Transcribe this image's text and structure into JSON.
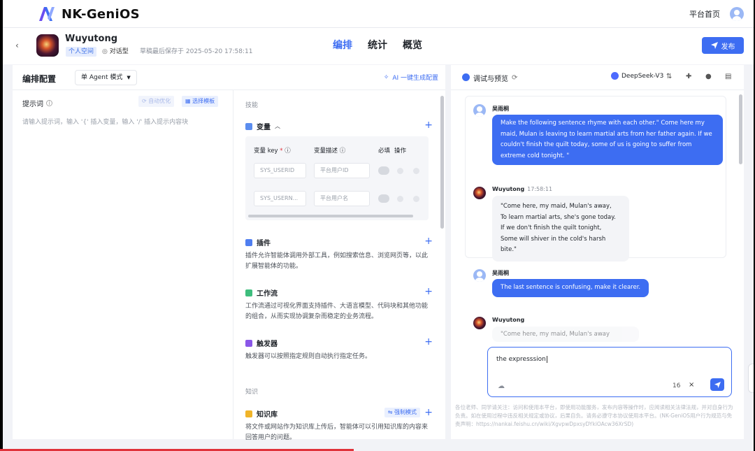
{
  "topbar": {
    "logo_text": "NK-GeniOS",
    "home_link": "平台首页"
  },
  "header": {
    "back": "‹",
    "agent_name": "Wuyutong",
    "space_tag": "个人空间",
    "type_tag": "对话型",
    "draft_time": "草稿最后保存于 2025-05-20 17:58:11",
    "tabs": [
      {
        "label": "编排",
        "active": true
      },
      {
        "label": "统计",
        "active": false
      },
      {
        "label": "概览",
        "active": false
      }
    ],
    "publish_label": "发布"
  },
  "left": {
    "title": "编排配置",
    "mode_select": "单 Agent 模式",
    "ai_generate": "AI 一键生成配置",
    "prompt": {
      "label": "提示词",
      "auto_optimize": "自动优化",
      "choose_template": "选择模板",
      "placeholder": "请输入提示词，输入 '{' 插入变量，输入 '/' 插入提示内容块"
    },
    "skills": {
      "section_label": "技能",
      "variables": {
        "name": "变量",
        "headers": {
          "key": "变量 key",
          "desc": "变量描述",
          "required": "必填",
          "action": "操作"
        },
        "rows": [
          {
            "key": "SYS_USERID",
            "desc": "平台用户ID"
          },
          {
            "key": "SYS_USERN...",
            "desc": "平台用户名"
          }
        ]
      },
      "plugins": {
        "name": "插件",
        "desc": "插件允许智能体调用外部工具，例如搜索信息、浏览网页等，以此扩展智能体的功能。"
      },
      "workflow": {
        "name": "工作流",
        "desc": "工作流通过可视化界面支持插件、大语言模型、代码块和其他功能的组合，从而实现协调复杂而稳定的业务流程。"
      },
      "trigger": {
        "name": "触发器",
        "desc": "触发器可以按照指定规则自动执行指定任务。"
      }
    },
    "knowledge": {
      "section_label": "知识",
      "kb": {
        "name": "知识库",
        "force_mode": "强制模式",
        "desc": "将文件或网站作为知识库上传后，智能体可以引用知识库的内容来回答用户的问题。"
      }
    }
  },
  "right": {
    "title": "调试与预览",
    "model": "DeepSeek-V3",
    "messages": [
      {
        "role": "user",
        "name": "吴雨桐",
        "text": "Make the following sentence rhyme with each other.\" Come here my maid, Mulan is leaving to learn martial arts from her father again. If we couldn't finish the quilt today, some of us is going to suffer from extreme cold tonight. \""
      },
      {
        "role": "bot",
        "name": "Wuyutong",
        "time": "17:58:11",
        "lines": [
          "\"Come here, my maid, Mulan's away,",
          "To learn martial arts, she's gone today.",
          "If we don't finish the quilt tonight,",
          "Some will shiver in the cold's harsh bite.\""
        ]
      },
      {
        "role": "user",
        "name": "吴雨桐",
        "text": "The last sentence is confusing, make it clearer."
      },
      {
        "role": "bot",
        "name": "Wuyutong",
        "text": "\"Come here, my maid, Mulan's away"
      }
    ],
    "input": {
      "value": "the expresssion",
      "count": "16"
    },
    "disclaimer": "各位老师、同学请关注：访问和使用本平台，即使用功能服务，发布内容等操作时，应阅读相关法律法规，并对自身行为负责。如在使用过程中违反相关规定或协议，后果自负。请务必遵守本协议使用本平台。(NK-GeniOS用户行为规范与免责声明：https://nankai.feishu.cn/wiki/XgvpwDpxsyDYkiOAcw36XrSD)"
  },
  "colors": {
    "accent": "#3d6df2",
    "progress": "#e0323a"
  }
}
